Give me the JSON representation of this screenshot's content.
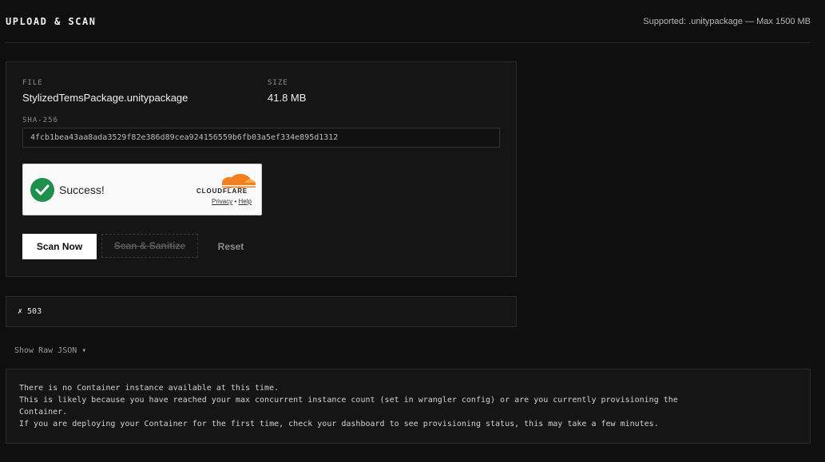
{
  "header": {
    "title": "UPLOAD & SCAN",
    "note": "Supported: .unitypackage — Max 1500 MB"
  },
  "file": {
    "file_label": "FILE",
    "file_name": "StylizedTemsPackage.unitypackage",
    "size_label": "SIZE",
    "size_value": "41.8 MB",
    "sha_label": "SHA-256",
    "sha_value": "4fcb1bea43aa8ada3529f82e386d89cea924156559b6fb03a5ef334e895d1312"
  },
  "turnstile": {
    "status": "Success!",
    "brand": "CLOUDFLARE",
    "privacy": "Privacy",
    "separator": "•",
    "help": "Help"
  },
  "actions": {
    "scan": "Scan Now",
    "sanitize": "Scan & Sanitize",
    "reset": "Reset"
  },
  "error": {
    "text": "✗ 503"
  },
  "raw": {
    "toggle": "Show Raw JSON ▾",
    "lines": [
      "There is no Container instance available at this time.",
      "This is likely because you have reached your max concurrent instance count (set in wrangler config) or are you currently provisioning the",
      "Container.",
      "If you are deploying your Container for the first time, check your dashboard to see provisioning status, this may take a few minutes."
    ]
  },
  "colors": {
    "background": "#0f0f0f",
    "success_green": "#1f8f4e",
    "cloudflare_orange": "#f38020"
  }
}
